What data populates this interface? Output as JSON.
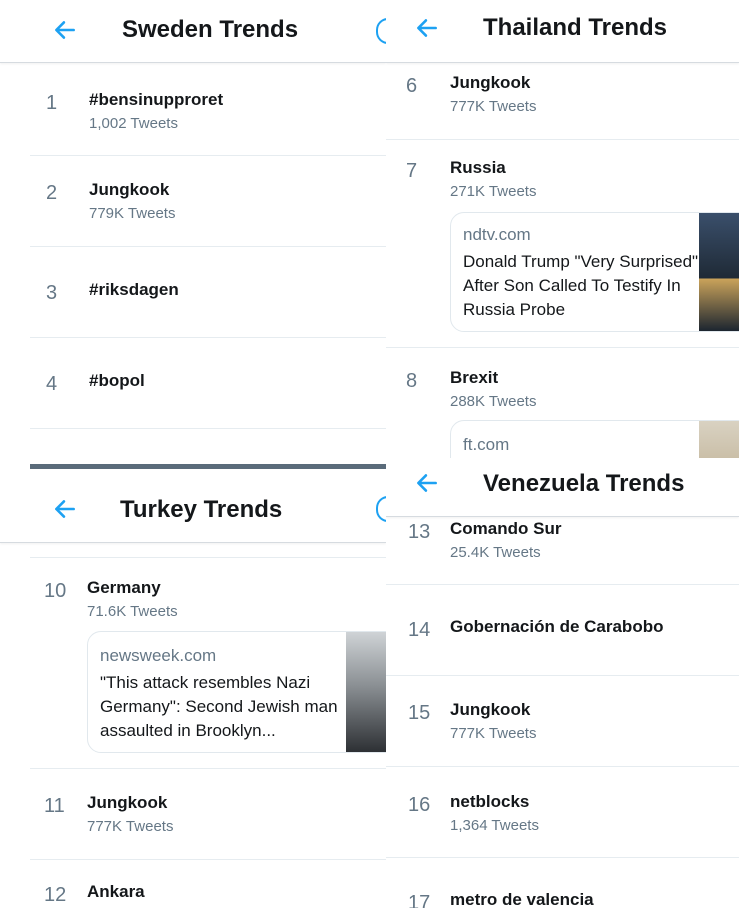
{
  "panels": {
    "sweden": {
      "title": "Sweden Trends",
      "trends": [
        {
          "rank": "1",
          "name": "#bensinupproret",
          "count": "1,002 Tweets"
        },
        {
          "rank": "2",
          "name": "Jungkook",
          "count": "779K Tweets"
        },
        {
          "rank": "3",
          "name": "#riksdagen"
        },
        {
          "rank": "4",
          "name": "#bopol"
        }
      ]
    },
    "thailand": {
      "title": "Thailand Trends",
      "trends": [
        {
          "rank": "6",
          "name": "Jungkook",
          "count": "777K Tweets"
        },
        {
          "rank": "7",
          "name": "Russia",
          "count": "271K Tweets",
          "card": {
            "domain": "ndtv.com",
            "headline": "Donald Trump \"Very Surprised\" After Son Called To Testify In Russia Probe"
          }
        },
        {
          "rank": "8",
          "name": "Brexit",
          "count": "288K Tweets",
          "card": {
            "domain": "ft.com"
          }
        }
      ]
    },
    "turkey": {
      "title": "Turkey Trends",
      "trends": [
        {
          "rank": "10",
          "name": "Germany",
          "count": "71.6K Tweets",
          "card": {
            "domain": "newsweek.com",
            "headline": "\"This attack resembles Nazi Germany\": Second Jewish man assaulted in Brooklyn..."
          }
        },
        {
          "rank": "11",
          "name": "Jungkook",
          "count": "777K Tweets"
        },
        {
          "rank": "12",
          "name": "Ankara"
        }
      ]
    },
    "venezuela": {
      "title": "Venezuela Trends",
      "trends": [
        {
          "rank": "13",
          "name": "Comando Sur",
          "count": "25.4K Tweets"
        },
        {
          "rank": "14",
          "name": "Gobernación de Carabobo"
        },
        {
          "rank": "15",
          "name": "Jungkook",
          "count": "777K Tweets"
        },
        {
          "rank": "16",
          "name": "netblocks",
          "count": "1,364 Tweets"
        },
        {
          "rank": "17",
          "name": "metro de valencia"
        }
      ]
    }
  },
  "colors": {
    "accent": "#1da1f2",
    "secondary_text": "#657786",
    "divider": "#e6ecf0"
  },
  "icons": {
    "back": "arrow-left-icon"
  }
}
